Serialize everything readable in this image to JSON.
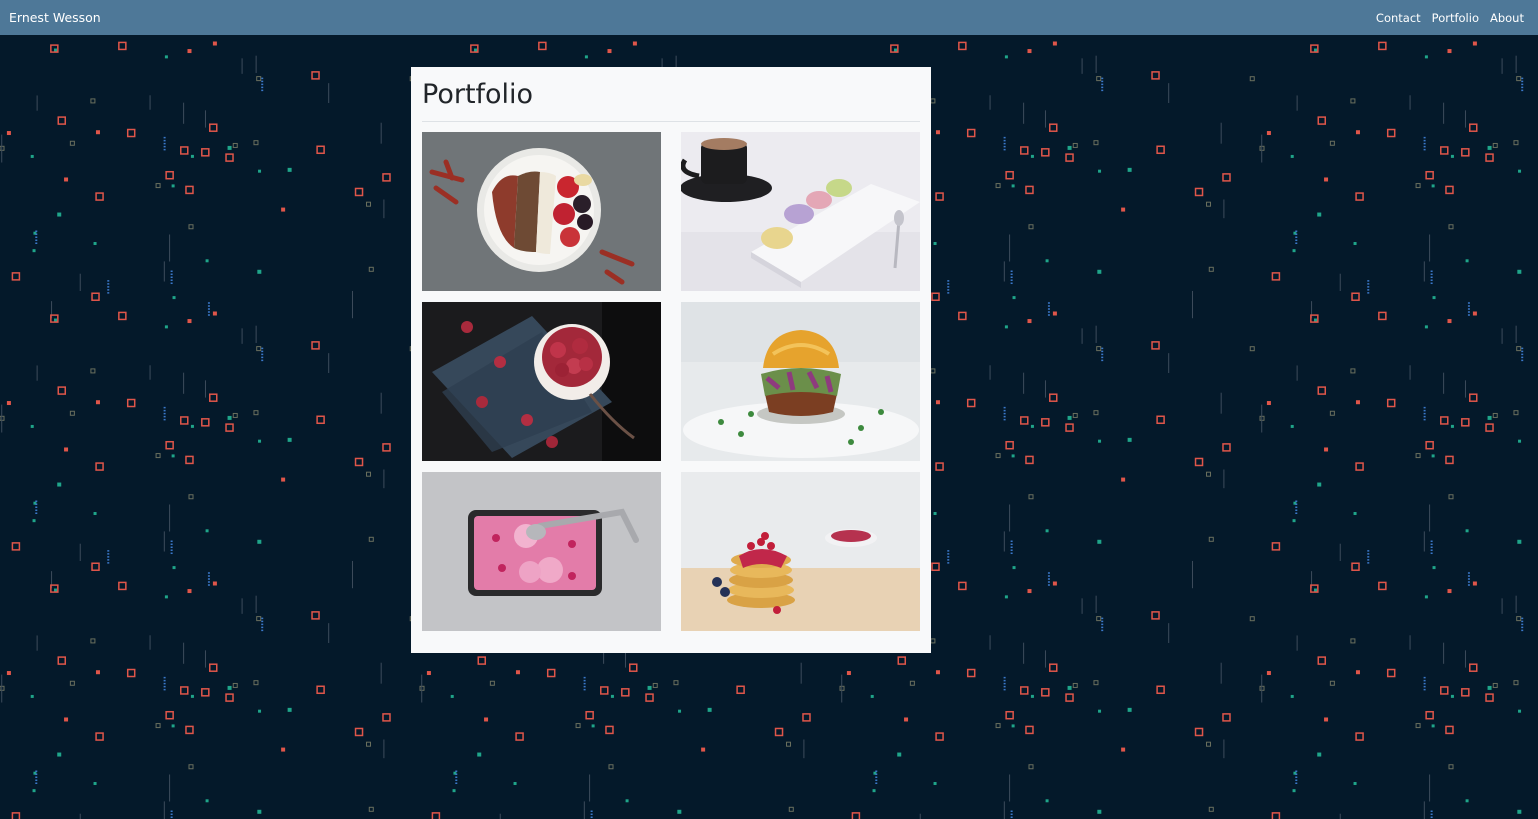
{
  "navbar": {
    "brand": "Ernest Wesson",
    "links": [
      "Contact",
      "Portfolio",
      "About"
    ]
  },
  "main": {
    "title": "Portfolio",
    "photos": [
      {
        "icon": "acai-bowl-photo"
      },
      {
        "icon": "coffee-macarons-photo"
      },
      {
        "icon": "raspberry-dessert-photo"
      },
      {
        "icon": "burger-photo"
      },
      {
        "icon": "pink-ice-cream-photo"
      },
      {
        "icon": "pancakes-berries-photo"
      }
    ]
  },
  "colors": {
    "navbar_bg": "#4e7898",
    "page_bg": "#04192a",
    "panel_bg": "#f8f9fa",
    "pattern_red": "#e0564a",
    "pattern_green": "#1fa58a",
    "pattern_blue": "#3a78c9"
  }
}
